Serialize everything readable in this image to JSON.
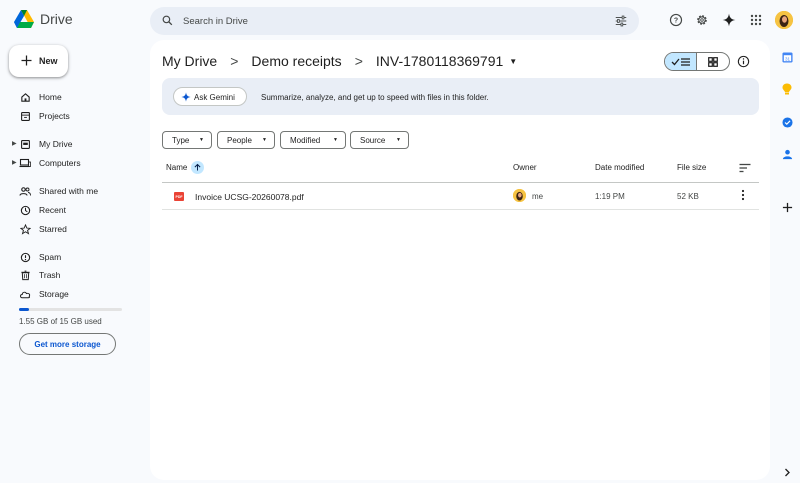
{
  "app": {
    "name": "Drive"
  },
  "search": {
    "placeholder": "Search in Drive"
  },
  "new_button": {
    "label": "New"
  },
  "nav": [
    {
      "label": "Home",
      "icon": "home-icon"
    },
    {
      "label": "Projects",
      "icon": "projects-icon"
    },
    {
      "label": "My Drive",
      "icon": "my-drive-icon"
    },
    {
      "label": "Computers",
      "icon": "computers-icon"
    },
    {
      "label": "Shared with me",
      "icon": "shared-icon"
    },
    {
      "label": "Recent",
      "icon": "clock-icon"
    },
    {
      "label": "Starred",
      "icon": "star-icon"
    },
    {
      "label": "Spam",
      "icon": "spam-icon"
    },
    {
      "label": "Trash",
      "icon": "trash-icon"
    },
    {
      "label": "Storage",
      "icon": "cloud-icon"
    }
  ],
  "storage": {
    "used_text": "1.55 GB of 15 GB used",
    "used_fraction": 0.1,
    "button": "Get more storage"
  },
  "breadcrumb": {
    "items": [
      "My Drive",
      "Demo receipts",
      "INV-1780118369791"
    ],
    "separator": ">"
  },
  "gemini": {
    "button": "Ask Gemini",
    "text": "Summarize, analyze, and get up to speed with files in this folder."
  },
  "filters": [
    "Type",
    "People",
    "Modified",
    "Source"
  ],
  "table": {
    "columns": {
      "name": "Name",
      "owner": "Owner",
      "date": "Date modified",
      "size": "File size"
    },
    "rows": [
      {
        "name": "Invoice UCSG-20260078.pdf",
        "owner": "me",
        "date": "1:19 PM",
        "size": "52 KB",
        "type_badge": "PDF"
      }
    ]
  },
  "colors": {
    "accent": "#0b57d0",
    "selected": "#c2e7ff",
    "surface": "#e9eef6",
    "pdf": "#ea4335"
  }
}
